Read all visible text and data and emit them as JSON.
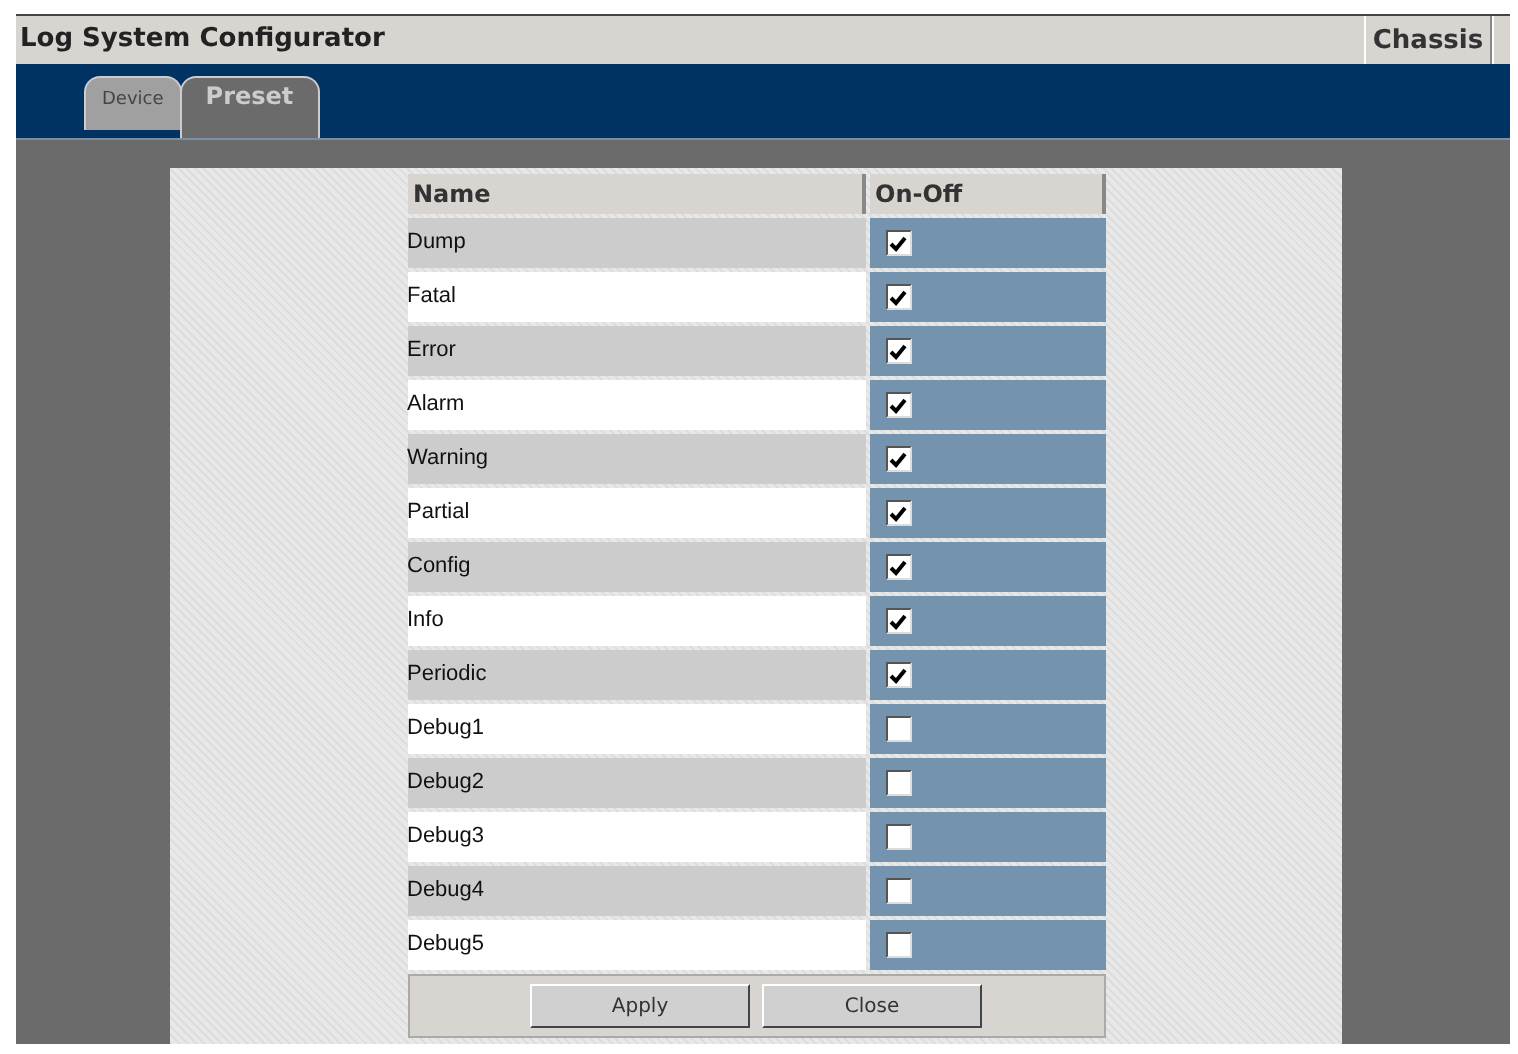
{
  "window": {
    "title": "Log System Configurator",
    "chassis_button": "Chassis"
  },
  "tabs": [
    {
      "label": "Device",
      "selected": false
    },
    {
      "label": "Preset",
      "selected": true
    }
  ],
  "table": {
    "columns": [
      "Name",
      "On-Off"
    ],
    "rows": [
      {
        "name": "Dump",
        "checked": true
      },
      {
        "name": "Fatal",
        "checked": true
      },
      {
        "name": "Error",
        "checked": true
      },
      {
        "name": "Alarm",
        "checked": true
      },
      {
        "name": "Warning",
        "checked": true
      },
      {
        "name": "Partial",
        "checked": true
      },
      {
        "name": "Config",
        "checked": true
      },
      {
        "name": "Info",
        "checked": true
      },
      {
        "name": "Periodic",
        "checked": true
      },
      {
        "name": "Debug1",
        "checked": false
      },
      {
        "name": "Debug2",
        "checked": false
      },
      {
        "name": "Debug3",
        "checked": false
      },
      {
        "name": "Debug4",
        "checked": false
      },
      {
        "name": "Debug5",
        "checked": false
      }
    ]
  },
  "buttons": [
    "Apply",
    "Close"
  ]
}
